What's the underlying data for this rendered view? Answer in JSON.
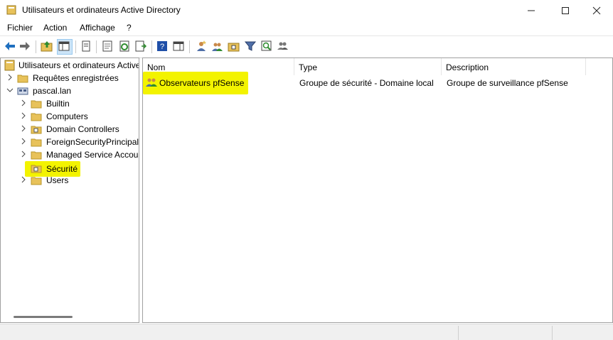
{
  "window": {
    "title": "Utilisateurs et ordinateurs Active Directory",
    "minimize_icon": "minimize-icon",
    "maximize_icon": "maximize-icon",
    "close_icon": "close-icon"
  },
  "menu": [
    "Fichier",
    "Action",
    "Affichage",
    "?"
  ],
  "toolbar": {
    "icons": [
      "back-icon",
      "forward-icon",
      "up-folder-icon",
      "show-hide-console-tree-icon",
      "copy-icon",
      "properties-icon",
      "refresh-icon",
      "export-list-icon",
      "help-icon",
      "action-pane-icon",
      "new-user-icon",
      "new-group-icon",
      "new-ou-icon",
      "filter-icon",
      "find-icon",
      "add-to-group-icon"
    ]
  },
  "tree": {
    "root": "Utilisateurs et ordinateurs Active Directory",
    "items": [
      {
        "label": "Requêtes enregistrées"
      },
      {
        "label": "pascal.lan"
      },
      {
        "label": "Builtin"
      },
      {
        "label": "Computers"
      },
      {
        "label": "Domain Controllers"
      },
      {
        "label": "ForeignSecurityPrincipals"
      },
      {
        "label": "Managed Service Accounts"
      },
      {
        "label": "Sécurité"
      },
      {
        "label": "Users"
      }
    ]
  },
  "list": {
    "columns": [
      "Nom",
      "Type",
      "Description"
    ],
    "rows": [
      {
        "name": "Observateurs pfSense",
        "type": "Groupe de sécurité - Domaine local",
        "description": "Groupe de surveillance pfSense"
      }
    ]
  },
  "colors": {
    "highlight": "#f3f300",
    "folder": "#e8c25a",
    "accent": "#1f6fbf"
  }
}
